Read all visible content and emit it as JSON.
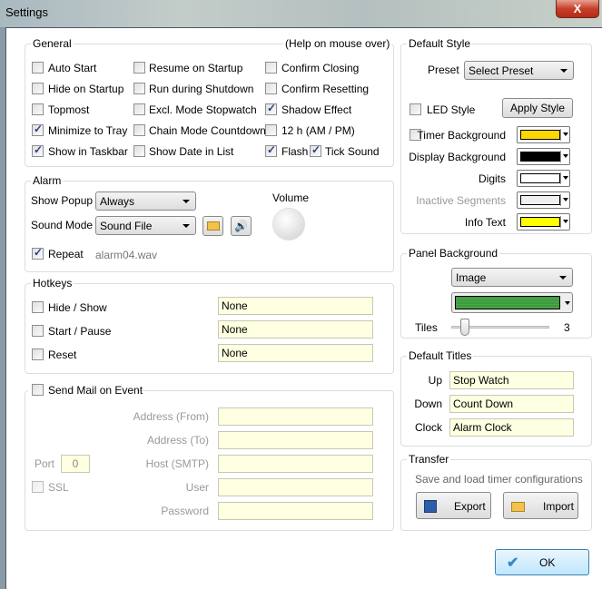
{
  "window": {
    "title": "Settings",
    "close": "X"
  },
  "general": {
    "title": "General",
    "help": "(Help on mouse over)",
    "options": [
      {
        "label": "Auto Start",
        "checked": false
      },
      {
        "label": "Resume on Startup",
        "checked": false
      },
      {
        "label": "Confirm Closing",
        "checked": false
      },
      {
        "label": "Hide on Startup",
        "checked": false
      },
      {
        "label": "Run during Shutdown",
        "checked": false
      },
      {
        "label": "Confirm Resetting",
        "checked": false
      },
      {
        "label": "Topmost",
        "checked": false
      },
      {
        "label": "Excl. Mode Stopwatch",
        "checked": false
      },
      {
        "label": "Shadow Effect",
        "checked": true
      },
      {
        "label": "Minimize to Tray",
        "checked": true
      },
      {
        "label": "Chain Mode Countdown",
        "checked": false
      },
      {
        "label": "12 h (AM / PM)",
        "checked": false
      },
      {
        "label": "Show in Taskbar",
        "checked": true
      },
      {
        "label": "Show Date in List",
        "checked": false
      },
      {
        "label": "Flash",
        "checked": true
      },
      {
        "label": "Tick Sound",
        "checked": true
      }
    ]
  },
  "alarm": {
    "title": "Alarm",
    "show_popup_label": "Show Popup",
    "show_popup_value": "Always",
    "sound_mode_label": "Sound Mode",
    "sound_mode_value": "Sound File",
    "volume_label": "Volume",
    "repeat_label": "Repeat",
    "repeat_checked": true,
    "file": "alarm04.wav"
  },
  "hotkeys": {
    "title": "Hotkeys",
    "items": [
      {
        "label": "Hide / Show",
        "value": "None"
      },
      {
        "label": "Start / Pause",
        "value": "None"
      },
      {
        "label": "Reset",
        "value": "None"
      }
    ]
  },
  "mail": {
    "title": "Send Mail on Event",
    "fields": [
      {
        "label": "Address (From)",
        "value": ""
      },
      {
        "label": "Address (To)",
        "value": ""
      },
      {
        "label": "Host (SMTP)",
        "value": ""
      },
      {
        "label": "User",
        "value": ""
      },
      {
        "label": "Password",
        "value": ""
      }
    ],
    "port_label": "Port",
    "port_value": "0",
    "ssl_label": "SSL"
  },
  "default_style": {
    "title": "Default Style",
    "preset_label": "Preset",
    "preset_value": "Select Preset",
    "led_label": "LED Style",
    "apply_label": "Apply Style",
    "colors": [
      {
        "label": "Timer Background",
        "color": "#ffd700"
      },
      {
        "label": "Display Background",
        "color": "#000000"
      },
      {
        "label": "Digits",
        "color": "#ffffff"
      },
      {
        "label": "Inactive Segments",
        "color": "#f0f0f0"
      },
      {
        "label": "Info Text",
        "color": "#ffff00"
      }
    ]
  },
  "panel_background": {
    "title": "Panel Background",
    "mode": "Image",
    "color": "#3f9a3f",
    "tiles_label": "Tiles",
    "tiles_value": "3"
  },
  "default_titles": {
    "title": "Default Titles",
    "items": [
      {
        "label": "Up",
        "value": "Stop Watch"
      },
      {
        "label": "Down",
        "value": "Count Down"
      },
      {
        "label": "Clock",
        "value": "Alarm Clock"
      }
    ]
  },
  "transfer": {
    "title": "Transfer",
    "description": "Save and load timer configurations",
    "export_label": "Export",
    "import_label": "Import"
  },
  "ok_label": "OK"
}
